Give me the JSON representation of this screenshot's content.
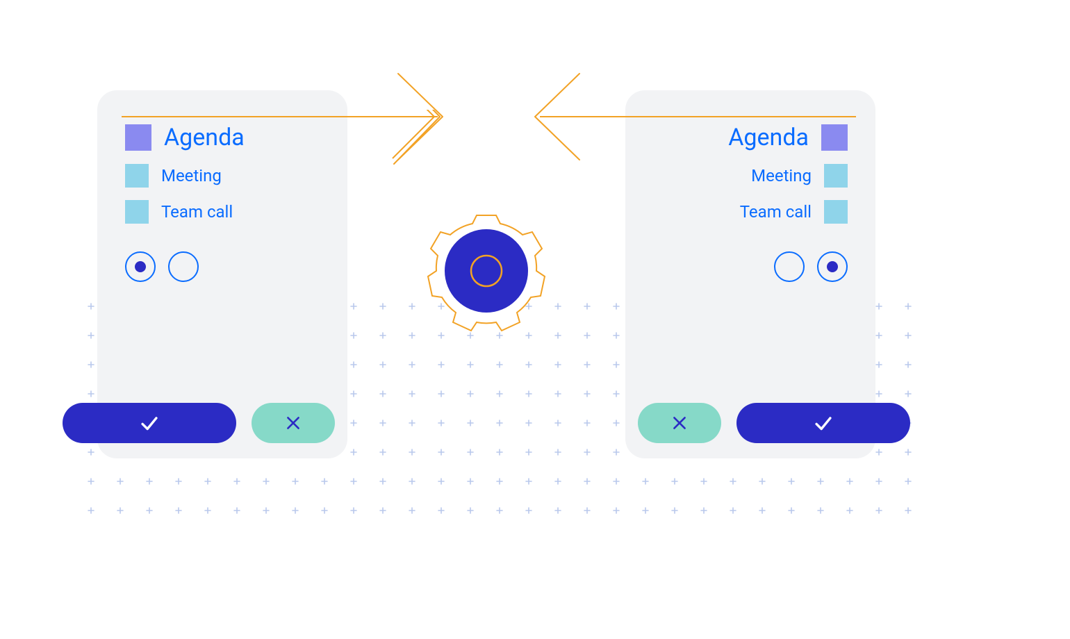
{
  "colors": {
    "accent_blue": "#0a6cff",
    "deep_indigo": "#2b2bc4",
    "swatch_title": "#8a8af0",
    "swatch_item": "#8fd4ea",
    "mint": "#86d9c8",
    "orange": "#f2a225",
    "card_bg": "#f2f3f5",
    "grid_plus": "#b9c8ec"
  },
  "cards": {
    "left": {
      "title": "Agenda",
      "items": [
        "Meeting",
        "Team call"
      ],
      "radio_selected_index": 0,
      "primary_side": "left"
    },
    "right": {
      "title": "Agenda",
      "items": [
        "Meeting",
        "Team call"
      ],
      "radio_selected_index": 1,
      "primary_side": "right"
    }
  },
  "icons": {
    "confirm": "check",
    "cancel": "cross"
  }
}
